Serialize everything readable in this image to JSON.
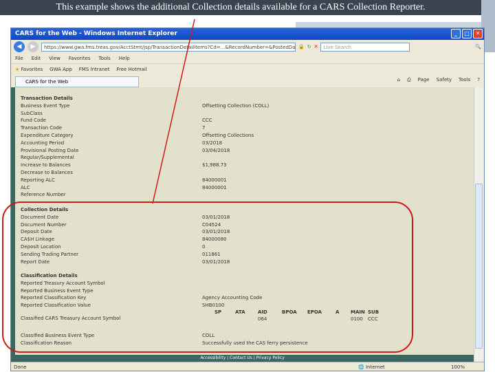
{
  "caption": "This example shows the additional Collection details available for a CARS Collection Reporter.",
  "browser": {
    "title": "CARS for the Web - Windows Internet Explorer",
    "url": "https://www.gwa.fms.treas.gov/AcctStmt/jsp/TransactionDetailItems?Cd=...&RecordNumber=&PostedDate=",
    "search_placeholder": "Live Search",
    "menu": [
      "File",
      "Edit",
      "View",
      "Favorites",
      "Tools",
      "Help"
    ],
    "favorites": [
      "Favorites",
      "GWA App",
      "FMS Intranet",
      "Free Hotmail"
    ],
    "tab": "CARS for the Web",
    "tools": [
      "Page",
      "Safety",
      "Tools"
    ],
    "status": "Done",
    "zone": "Internet",
    "zoom": "100%",
    "footer": "Accessibility | Contact Us | Privacy Policy"
  },
  "transaction": {
    "header": "Transaction Details",
    "rows": [
      [
        "Business Event Type",
        "Offsetting Collection (COLL)"
      ],
      [
        "SubClass",
        ""
      ],
      [
        "Fund Code",
        "CCC"
      ],
      [
        "Transaction Code",
        "7"
      ],
      [
        "Expenditure Category",
        "Offsetting Collections"
      ],
      [
        "Accounting Period",
        "03/2018"
      ],
      [
        "Provisional Posting Date",
        "03/04/2018"
      ],
      [
        "Regular/Supplemental",
        ""
      ],
      [
        "Increase to Balances",
        "$1,988.73"
      ],
      [
        "Decrease to Balances",
        ""
      ],
      [
        "Reporting ALC",
        "84000001"
      ],
      [
        "ALC",
        "84000001"
      ],
      [
        "Reference Number",
        ""
      ]
    ]
  },
  "collection": {
    "header": "Collection Details",
    "rows": [
      [
        "Document Date",
        "03/01/2018"
      ],
      [
        "Document Number",
        "C04524"
      ],
      [
        "Deposit Date",
        "03/01/2018"
      ],
      [
        "CA$H Linkage",
        "84000080"
      ],
      [
        "Deposit Location",
        "0"
      ],
      [
        "Sending Trading Partner",
        "011861"
      ],
      [
        "Report Date",
        "03/01/2018"
      ]
    ]
  },
  "classification": {
    "header": "Classification Details",
    "rows": [
      [
        "Reported Treasury Account Symbol",
        ""
      ],
      [
        "Reported Business Event Type",
        ""
      ],
      [
        "Reported Classification Key",
        "Agency Accounting Code"
      ],
      [
        "Reported Classification Value",
        "SHB0100"
      ]
    ],
    "tas_label": "Classified CARS Treasury Account Symbol",
    "tas_cols": [
      "SP",
      "ATA",
      "AID",
      "BPOA",
      "EPOA",
      "A",
      "MAIN",
      "SUB"
    ],
    "tas_vals": [
      "",
      "",
      "064",
      "",
      "",
      "",
      "0100",
      "CCC"
    ],
    "rows2": [
      [
        "Classified Business Event Type",
        "COLL"
      ],
      [
        "Classification Reason",
        "Successfully used the CAS ferry persistence"
      ]
    ]
  }
}
